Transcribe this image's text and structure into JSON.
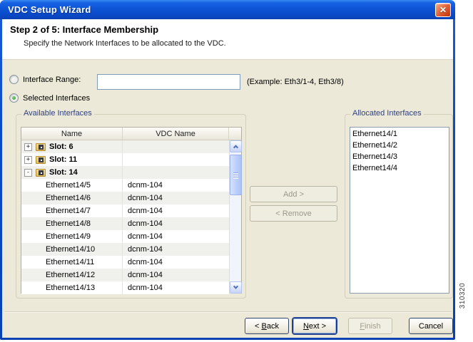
{
  "window": {
    "title": "VDC Setup Wizard",
    "close_glyph": "✕"
  },
  "header": {
    "title": "Step 2 of 5: Interface Membership",
    "description": "Specify the Network Interfaces to be allocated to the VDC."
  },
  "options": {
    "interface_range_label": "Interface Range:",
    "interface_range_value": "",
    "example_hint": "(Example: Eth3/1-4, Eth3/8)",
    "selected_interfaces_label": "Selected Interfaces",
    "selected_option": "Selected Interfaces"
  },
  "available": {
    "group_label": "Available Interfaces",
    "columns": [
      "Name",
      "VDC Name"
    ],
    "rows": [
      {
        "type": "slot",
        "expander": "+",
        "name": "Slot: 6",
        "vdc": ""
      },
      {
        "type": "slot",
        "expander": "+",
        "name": "Slot: 11",
        "vdc": ""
      },
      {
        "type": "slot",
        "expander": "-",
        "name": "Slot: 14",
        "vdc": ""
      },
      {
        "type": "interface",
        "name": "Ethernet14/5",
        "vdc": "dcnm-104"
      },
      {
        "type": "interface",
        "name": "Ethernet14/6",
        "vdc": "dcnm-104"
      },
      {
        "type": "interface",
        "name": "Ethernet14/7",
        "vdc": "dcnm-104"
      },
      {
        "type": "interface",
        "name": "Ethernet14/8",
        "vdc": "dcnm-104"
      },
      {
        "type": "interface",
        "name": "Ethernet14/9",
        "vdc": "dcnm-104"
      },
      {
        "type": "interface",
        "name": "Ethernet14/10",
        "vdc": "dcnm-104"
      },
      {
        "type": "interface",
        "name": "Ethernet14/11",
        "vdc": "dcnm-104"
      },
      {
        "type": "interface",
        "name": "Ethernet14/12",
        "vdc": "dcnm-104"
      },
      {
        "type": "interface",
        "name": "Ethernet14/13",
        "vdc": "dcnm-104"
      }
    ]
  },
  "transfer": {
    "add_label": "Add >",
    "remove_label": "< Remove"
  },
  "allocated": {
    "group_label": "Allocated Interfaces",
    "items": [
      "Ethernet14/1",
      "Ethernet14/2",
      "Ethernet14/3",
      "Ethernet14/4"
    ]
  },
  "footer": {
    "buttons": [
      {
        "key": "back",
        "label": "< Back",
        "underline": 2,
        "state": "enabled"
      },
      {
        "key": "next",
        "label": "Next >",
        "underline": 0,
        "state": "focused"
      },
      {
        "key": "finish",
        "label": "Finish",
        "underline": 0,
        "state": "disabled"
      },
      {
        "key": "cancel",
        "label": "Cancel",
        "underline": -1,
        "state": "enabled"
      }
    ]
  },
  "figure_number": "310320",
  "colors": {
    "titlebar_blue": "#0d55d6",
    "dialog_background": "#ece9d8",
    "group_label_blue": "#30407f",
    "close_button_red": "#cc3f15",
    "selected_radio_green": "#2f9a2f",
    "scrollbar_blue": "#bed1fa",
    "row_shade": "#f0f1ec"
  }
}
